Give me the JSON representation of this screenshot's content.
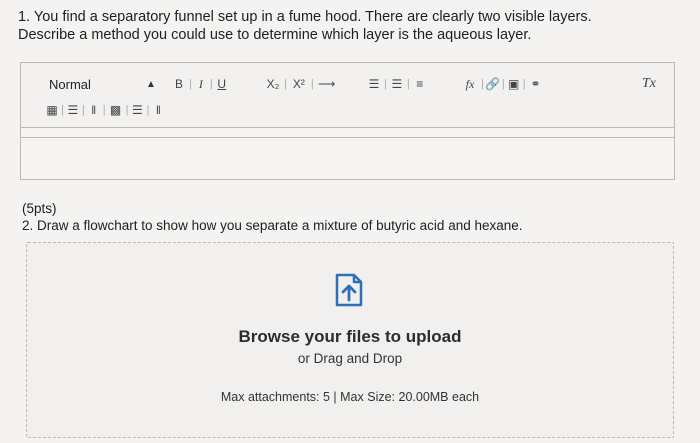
{
  "question1": {
    "line1": "1. You find a separatory funnel set up in a fume hood. There are clearly two visible layers.",
    "line2": "Describe a method you could use to determine which layer is the aqueous layer."
  },
  "toolbar": {
    "format_value": "Normal",
    "bold": "B",
    "italic": "I",
    "underline": "U",
    "subscript": "X₂",
    "superscript": "X²",
    "formula": "fx",
    "clear_format": "Tx"
  },
  "question2": {
    "points": "(5pts)",
    "text": "2. Draw a flowchart to show how you separate a mixture of butyric acid and hexane."
  },
  "upload": {
    "browse_label": "Browse your files to upload",
    "drag_label": "or Drag and Drop",
    "limits": "Max attachments: 5 | Max Size: 20.00MB each"
  }
}
